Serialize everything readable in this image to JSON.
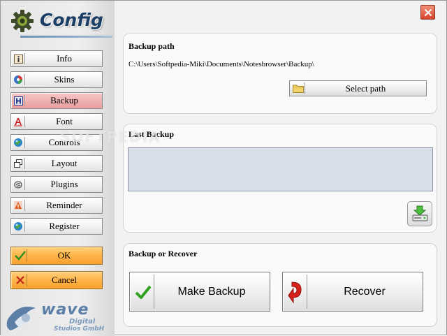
{
  "window": {
    "title": "Config"
  },
  "sidebar": {
    "items": [
      {
        "label": "Info",
        "icon": "info-icon"
      },
      {
        "label": "Skins",
        "icon": "skins-icon"
      },
      {
        "label": "Backup",
        "icon": "backup-icon",
        "active": true
      },
      {
        "label": "Font",
        "icon": "font-icon"
      },
      {
        "label": "Controls",
        "icon": "controls-icon"
      },
      {
        "label": "Layout",
        "icon": "layout-icon"
      },
      {
        "label": "Plugins",
        "icon": "plugins-icon"
      },
      {
        "label": "Reminder",
        "icon": "reminder-icon"
      },
      {
        "label": "Register",
        "icon": "register-icon"
      }
    ],
    "ok_label": "OK",
    "cancel_label": "Cancel"
  },
  "brand": {
    "name": "wave",
    "line1": "Digital",
    "line2": "Studios GmbH"
  },
  "watermark": "SOFTPEDIA",
  "backup_path": {
    "title": "Backup path",
    "path": "C:\\Users\\Softpedia-Miki\\Documents\\Notesbrowser\\Backup\\",
    "select_label": "Select path"
  },
  "last_backup": {
    "title": "Last Backup",
    "value": ""
  },
  "backup_or_recover": {
    "title": "Backup or Recover",
    "make_backup_label": "Make Backup",
    "recover_label": "Recover"
  },
  "colors": {
    "accent_title": "#1c3f66",
    "active_nav": "#eeb0b0",
    "action_orange": "#ffb44a",
    "close_red": "#d6452c"
  }
}
